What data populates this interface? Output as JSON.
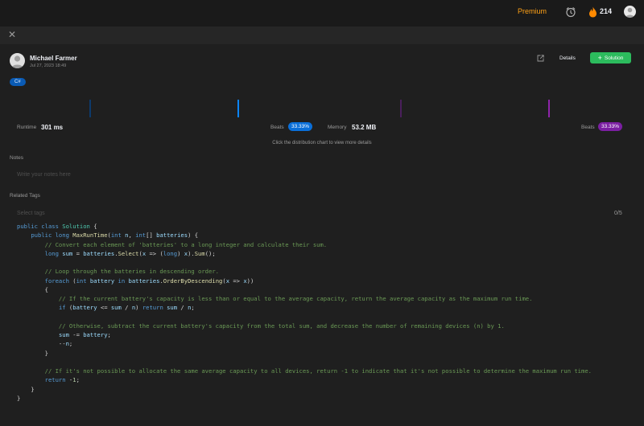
{
  "topbar": {
    "premium_label": "Premium",
    "streak_count": "214",
    "icons": [
      "alarm-clock-icon",
      "flame-icon",
      "user-avatar"
    ]
  },
  "submission": {
    "author": "Michael Farmer",
    "date": "Jul 27, 2023 18:49",
    "language": "C#",
    "details_label": "Details",
    "solution_label": "Solution"
  },
  "stats": {
    "runtime_label": "Runtime",
    "runtime_value": "301 ms",
    "runtime_beats_label": "Beats",
    "runtime_beats_value": "33.33%",
    "memory_label": "Memory",
    "memory_value": "53.2 MB",
    "memory_beats_label": "Beats",
    "memory_beats_value": "33.33%",
    "hint": "Click the distribution chart to view more details"
  },
  "notes": {
    "label": "Notes",
    "placeholder": "Write your notes here"
  },
  "tags": {
    "label": "Related Tags",
    "placeholder": "Select tags",
    "count": "0/5"
  },
  "code_lines": [
    "public class Solution {",
    "    public long MaxRunTime(int n, int[] batteries) {",
    "        // Convert each element of 'batteries' to a long integer and calculate their sum.",
    "        long sum = batteries.Select(x => (long) x).Sum();",
    "",
    "        // Loop through the batteries in descending order.",
    "        foreach (int battery in batteries.OrderByDescending(x => x))",
    "        {",
    "            // If the current battery's capacity is less than or equal to the average capacity, return the average capacity as the maximum run time.",
    "            if (battery <= sum / n) return sum / n;",
    "",
    "            // Otherwise, subtract the current battery's capacity from the total sum, and decrease the number of remaining devices (n) by 1.",
    "            sum -= battery;",
    "            --n;",
    "        }",
    "",
    "        // If it's not possible to allocate the same average capacity to all devices, return -1 to indicate that it's not possible to determine the maximum run time.",
    "        return -1;",
    "    }",
    "}"
  ],
  "colors": {
    "accent_green": "#2cbb5d",
    "premium_orange": "#ffa116",
    "runtime_blue": "#0a84ff",
    "memory_purple": "#8e24aa"
  }
}
